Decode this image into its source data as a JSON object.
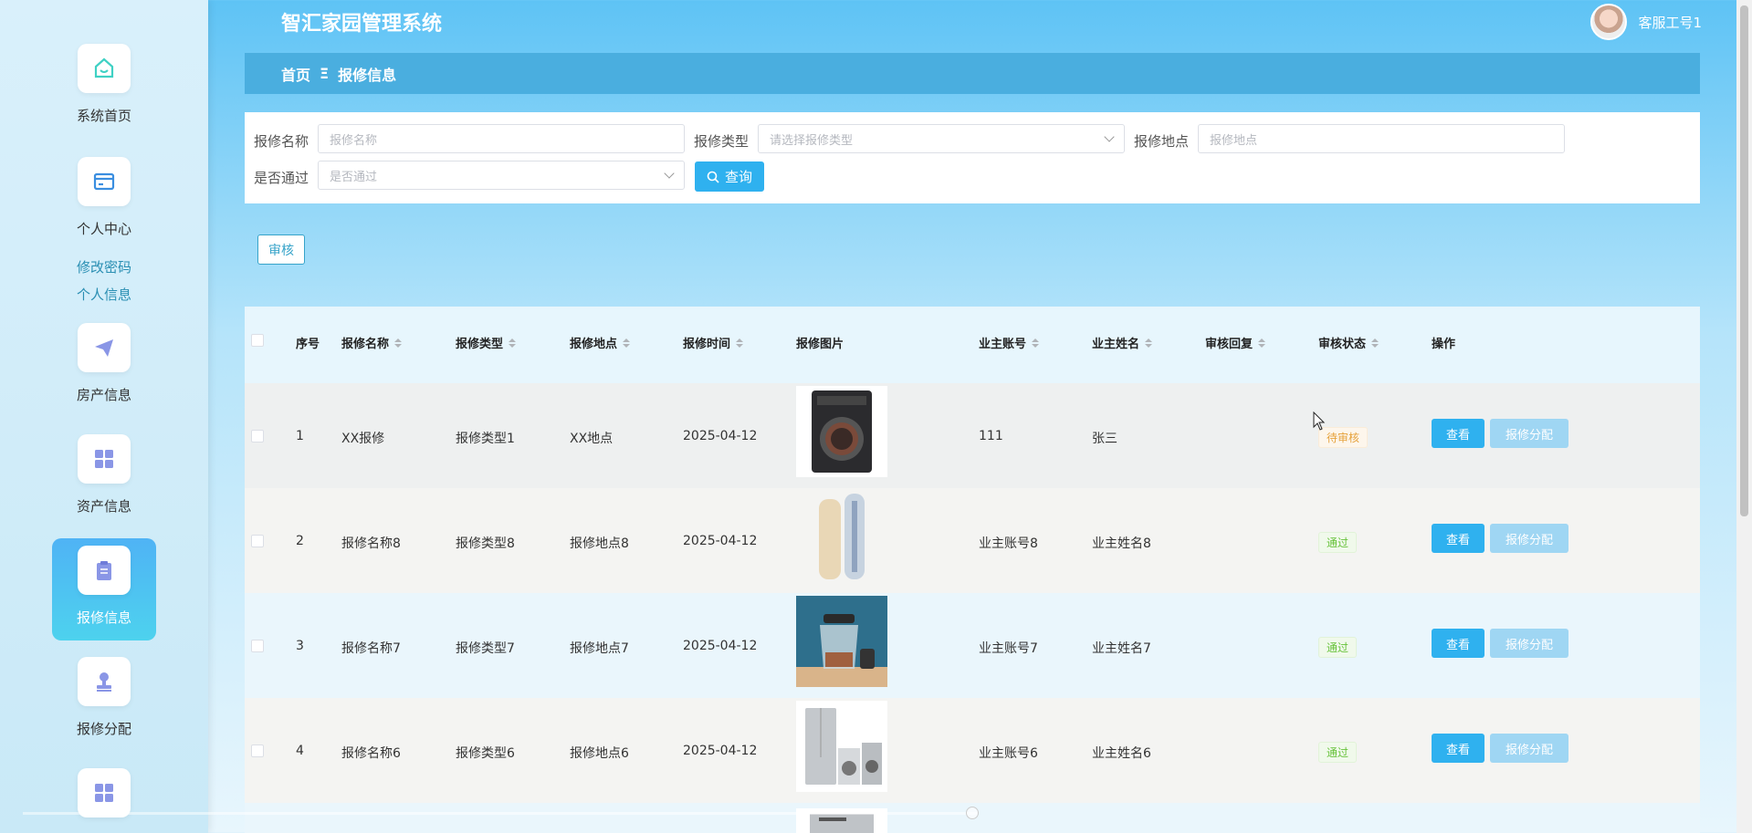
{
  "app": {
    "title": "智汇家园管理系统",
    "user_name": "客服工号1"
  },
  "sidebar": {
    "items": [
      {
        "label": "系统首页",
        "icon": "home-icon"
      },
      {
        "label": "个人中心",
        "icon": "card-icon"
      },
      {
        "label": "房产信息",
        "icon": "send-icon"
      },
      {
        "label": "资产信息",
        "icon": "grid-icon"
      },
      {
        "label": "报修信息",
        "icon": "clipboard-icon"
      },
      {
        "label": "报修分配",
        "icon": "stamp-icon"
      },
      {
        "label": "",
        "icon": "grid-icon"
      }
    ],
    "sub_links": [
      "修改密码",
      "个人信息"
    ],
    "active": "报修信息"
  },
  "breadcrumb": {
    "home": "首页",
    "separator": "Ξ",
    "current": "报修信息"
  },
  "search": {
    "name_label": "报修名称",
    "name_placeholder": "报修名称",
    "type_label": "报修类型",
    "type_placeholder": "请选择报修类型",
    "location_label": "报修地点",
    "location_placeholder": "报修地点",
    "passed_label": "是否通过",
    "passed_placeholder": "是否通过",
    "query_button": "查询"
  },
  "toolbar": {
    "audit_button": "审核"
  },
  "table": {
    "headers": [
      "序号",
      "报修名称",
      "报修类型",
      "报修地点",
      "报修时间",
      "报修图片",
      "业主账号",
      "业主姓名",
      "审核回复",
      "审核状态",
      "操作"
    ],
    "rows": [
      {
        "index": "1",
        "name": "XX报修",
        "type": "报修类型1",
        "location": "XX地点",
        "time": "2025-04-12",
        "image": "washing-machine",
        "account": "111",
        "owner": "张三",
        "reply": "",
        "status": "待审核",
        "status_kind": "pending"
      },
      {
        "index": "2",
        "name": "报修名称8",
        "type": "报修类型8",
        "location": "报修地点8",
        "time": "2025-04-12",
        "image": "air-conditioner",
        "account": "业主账号8",
        "owner": "业主姓名8",
        "reply": "",
        "status": "通过",
        "status_kind": "pass"
      },
      {
        "index": "3",
        "name": "报修名称7",
        "type": "报修类型7",
        "location": "报修地点7",
        "time": "2025-04-12",
        "image": "food-processor",
        "account": "业主账号7",
        "owner": "业主姓名7",
        "reply": "",
        "status": "通过",
        "status_kind": "pass"
      },
      {
        "index": "4",
        "name": "报修名称6",
        "type": "报修类型6",
        "location": "报修地点6",
        "time": "2025-04-12",
        "image": "appliances",
        "account": "业主账号6",
        "owner": "业主姓名6",
        "reply": "",
        "status": "通过",
        "status_kind": "pass"
      }
    ],
    "view_button": "查看",
    "assign_button": "报修分配"
  },
  "colors": {
    "primary": "#2fb1ef",
    "breadcrumb_bg": "#4aaedf",
    "pending": "#e6a23c",
    "pass": "#67c23a"
  }
}
